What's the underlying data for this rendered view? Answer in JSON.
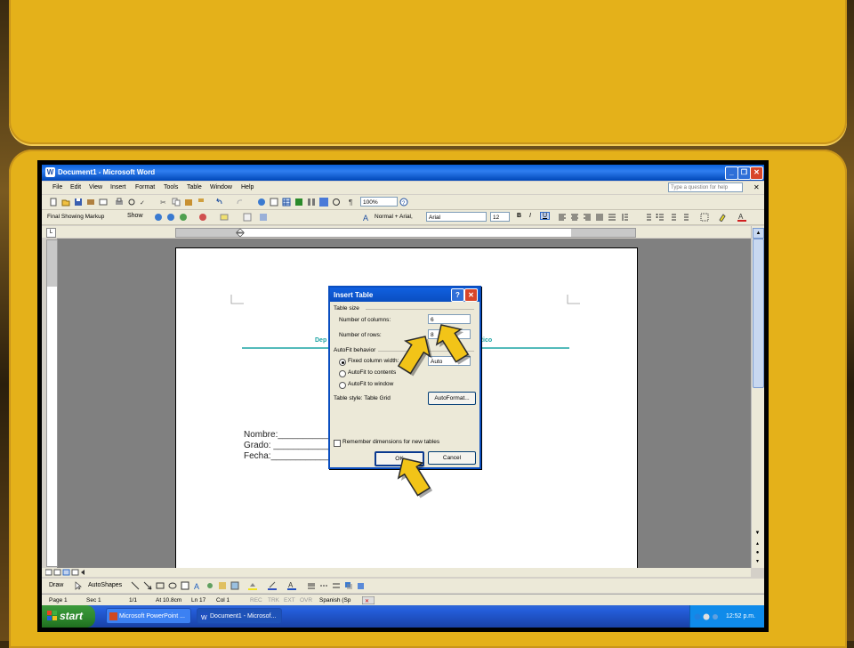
{
  "window": {
    "title": "Document1 - Microsoft Word"
  },
  "menu": {
    "items": [
      "File",
      "Edit",
      "View",
      "Insert",
      "Format",
      "Tools",
      "Table",
      "Window",
      "Help"
    ],
    "help_placeholder": "Type a question for help"
  },
  "toolbar": {
    "zoom": "100%"
  },
  "formatting": {
    "markup_mode": "Final Showing Markup",
    "show_label": "Show",
    "style": "Normal + Arial,",
    "font": "Arial",
    "size": "12"
  },
  "document": {
    "header_left": "Dep",
    "header_right": "Rico",
    "form_lines": [
      "Nombre:______________",
      "Grado: ______________",
      "Fecha:_______________"
    ]
  },
  "dialog": {
    "title": "Insert Table",
    "table_size_label": "Table size",
    "columns_label": "Number of columns:",
    "columns_value": "6",
    "rows_label": "Number of rows:",
    "rows_value": "8",
    "autofit_label": "AutoFit behavior",
    "fixed_width_label": "Fixed column width:",
    "fixed_width_value": "Auto",
    "autofit_contents_label": "AutoFit to contents",
    "autofit_window_label": "AutoFit to window",
    "table_style_label": "Table style:  Table Grid",
    "autoformat_label": "AutoFormat...",
    "remember_label": "Remember dimensions for new tables",
    "ok_label": "OK",
    "cancel_label": "Cancel"
  },
  "drawbar": {
    "draw_label": "Draw",
    "autoshapes_label": "AutoShapes"
  },
  "status": {
    "page": "Page 1",
    "section": "Sec 1",
    "pages": "1/1",
    "at": "At 10.8cm",
    "line": "Ln 17",
    "col": "Col 1",
    "rec": "REC",
    "trk": "TRK",
    "ext": "EXT",
    "ovr": "OVR",
    "language": "Spanish (Sp"
  },
  "taskbar": {
    "start_label": "start",
    "items": [
      "Microsoft PowerPoint ...",
      "Document1 - Microsof..."
    ],
    "clock": "12:52 p.m."
  },
  "colors": {
    "slide_gold": "#e4b11a",
    "arrow_yellow": "#f2c418",
    "xp_blue": "#0a4ec0",
    "header_teal": "#1aa3a3"
  }
}
